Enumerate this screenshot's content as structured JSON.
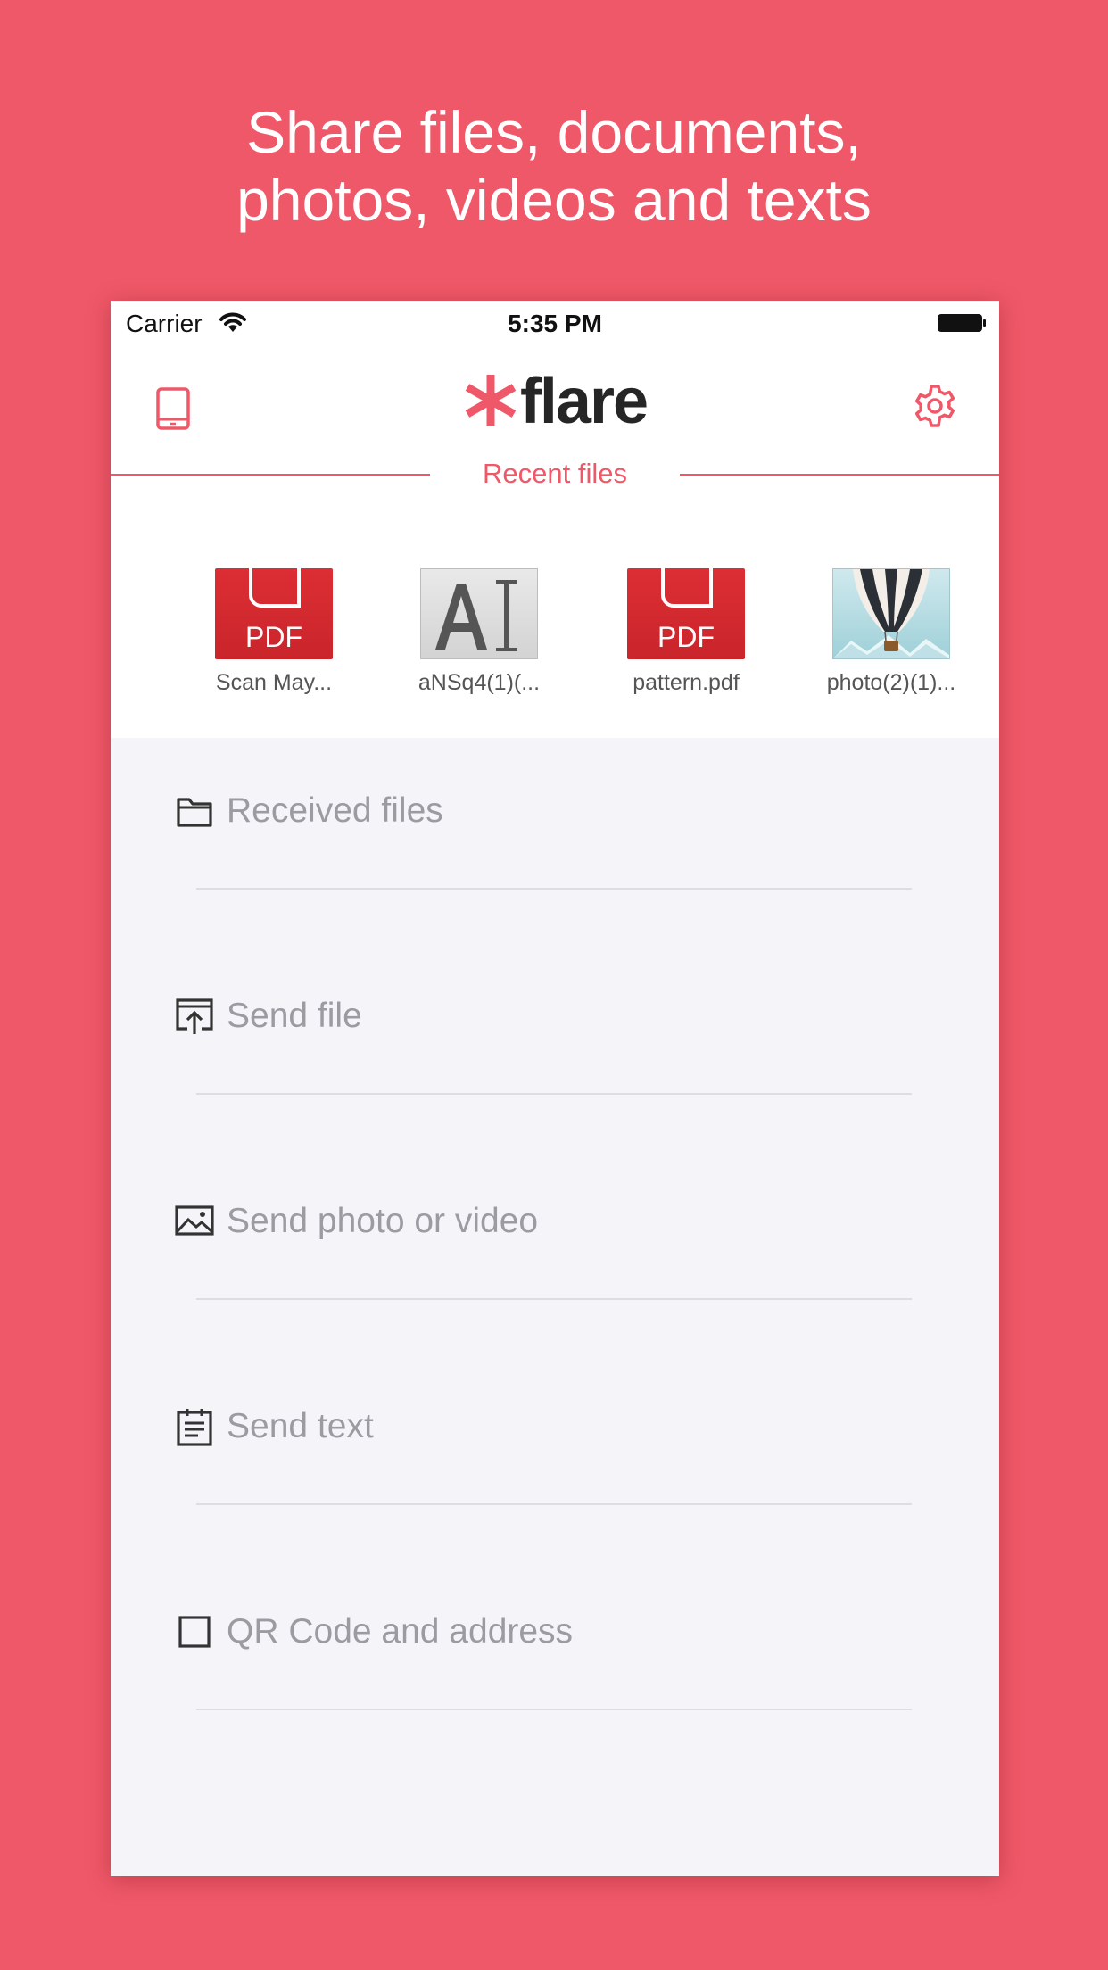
{
  "headline": {
    "line1": "Share files, documents,",
    "line2": "photos, videos and texts"
  },
  "status_bar": {
    "carrier": "Carrier",
    "time": "5:35 PM"
  },
  "nav": {
    "logo_text": "flare",
    "left_icon": "tablet-icon",
    "right_icon": "gear-icon"
  },
  "recent": {
    "title": "Recent files",
    "files": [
      {
        "name": "Scan May...",
        "type": "pdf",
        "badge": "PDF"
      },
      {
        "name": "aNSq4(1)(...",
        "type": "ai",
        "badge": "AI"
      },
      {
        "name": "pattern.pdf",
        "type": "pdf",
        "badge": "PDF"
      },
      {
        "name": "photo(2)(1)...",
        "type": "photo"
      }
    ]
  },
  "menu": [
    {
      "label": "Received files",
      "icon": "folder-icon"
    },
    {
      "label": "Send file",
      "icon": "upload-icon"
    },
    {
      "label": "Send photo or video",
      "icon": "image-icon"
    },
    {
      "label": "Send text",
      "icon": "notepad-icon"
    },
    {
      "label": "QR Code and address",
      "icon": "qr-square-icon"
    }
  ],
  "colors": {
    "brand": "#ef5868",
    "pdf": "#d42a30",
    "menu_text": "#9b9ba2",
    "list_bg": "#f5f5f9"
  }
}
